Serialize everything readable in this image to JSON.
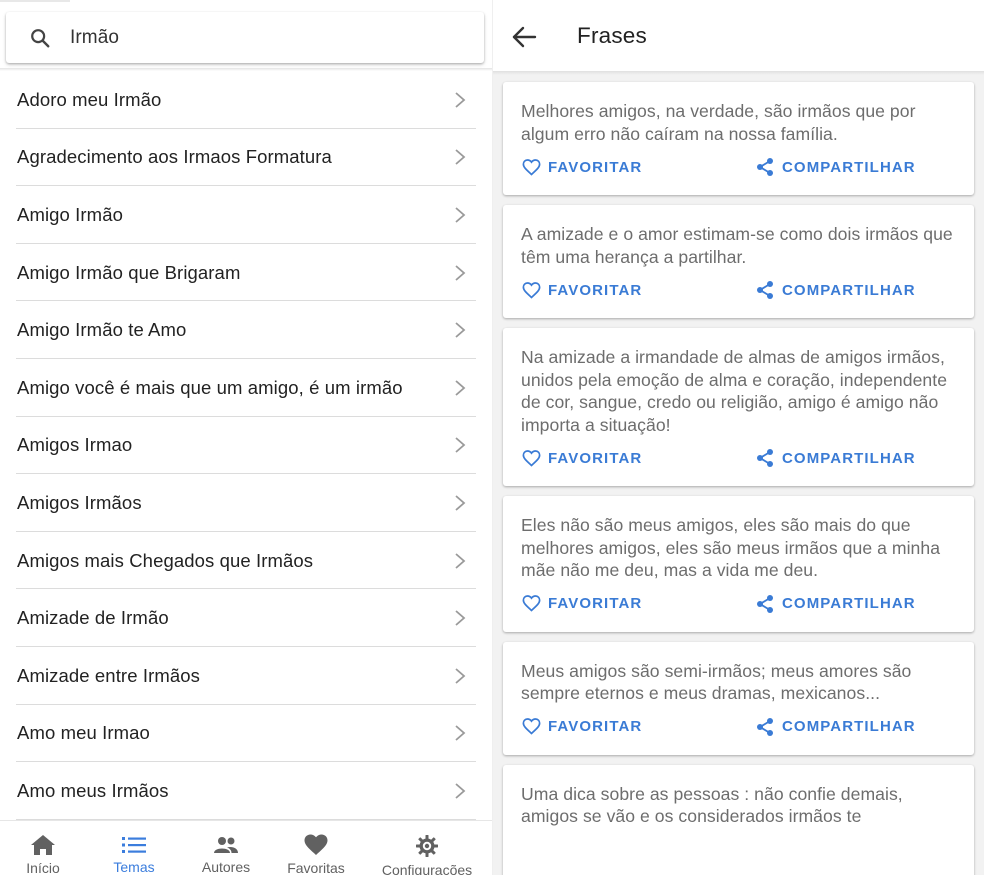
{
  "colors": {
    "accent": "#3a7bd5",
    "nav_active": "#3b7ddd",
    "text_primary": "#222222",
    "text_quote": "#6d6d6d"
  },
  "search": {
    "value": "Irmão",
    "icon": "search-icon"
  },
  "themes": [
    {
      "label": "Adoro meu Irmão"
    },
    {
      "label": "Agradecimento aos Irmaos Formatura"
    },
    {
      "label": "Amigo Irmão"
    },
    {
      "label": "Amigo Irmão que Brigaram"
    },
    {
      "label": "Amigo Irmão te Amo"
    },
    {
      "label": "Amigo você é mais que um amigo, é um irmão"
    },
    {
      "label": "Amigos Irmao"
    },
    {
      "label": "Amigos Irmãos"
    },
    {
      "label": "Amigos mais Chegados que Irmãos"
    },
    {
      "label": "Amizade de Irmão"
    },
    {
      "label": "Amizade entre Irmãos"
    },
    {
      "label": "Amo meu Irmao"
    },
    {
      "label": "Amo meus Irmãos"
    }
  ],
  "bottom_nav": [
    {
      "label": "Início",
      "icon": "home-icon",
      "active": false
    },
    {
      "label": "Temas",
      "icon": "list-icon",
      "active": true
    },
    {
      "label": "Autores",
      "icon": "people-icon",
      "active": false
    },
    {
      "label": "Favoritas",
      "icon": "heart-icon",
      "active": false
    },
    {
      "label": "Configurações",
      "icon": "gear-icon",
      "active": false
    }
  ],
  "header": {
    "title": "Frases",
    "back_icon": "arrow-back-icon"
  },
  "actions": {
    "favorite_label": "FAVORITAR",
    "share_label": "COMPARTILHAR"
  },
  "quotes": [
    {
      "text": "Melhores amigos, na verdade, são irmãos que por algum erro não caíram na nossa família."
    },
    {
      "text": "A amizade e o amor estimam-se como dois irmãos que têm uma herança a partilhar."
    },
    {
      "text": "Na amizade a irmandade de almas de amigos irmãos, unidos pela emoção de alma e coração, independente de cor, sangue, credo ou religião, amigo é amigo não importa a situação!"
    },
    {
      "text": "Eles não são meus amigos, eles são mais do que melhores amigos, eles são meus irmãos que a minha mãe não me deu, mas a vida me deu."
    },
    {
      "text": "Meus amigos são semi-irmãos; meus amores são sempre eternos e meus dramas, mexicanos..."
    },
    {
      "text": "Uma dica sobre as pessoas : não confie demais, amigos se vão e os considerados irmãos te"
    }
  ]
}
